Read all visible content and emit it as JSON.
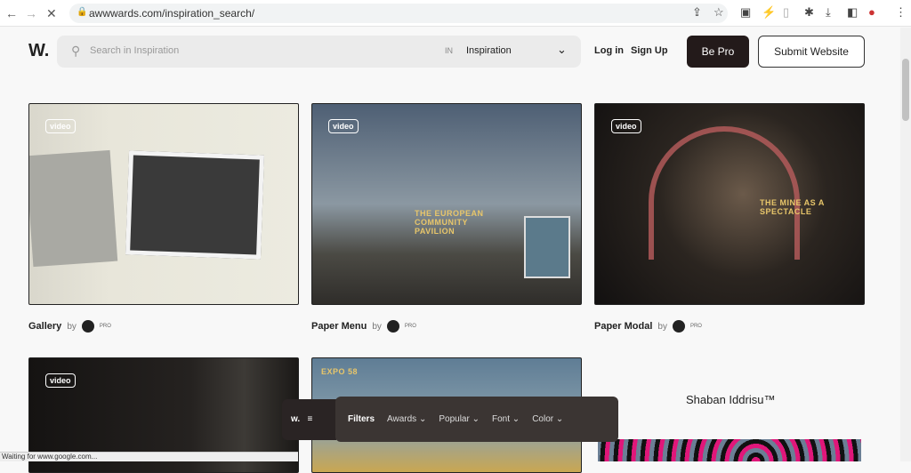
{
  "browser": {
    "url": "awwwards.com/inspiration_search/",
    "status": "Waiting for www.google.com..."
  },
  "header": {
    "logo": "W.",
    "search_placeholder": "Search in Inspiration",
    "in_label": "IN",
    "category": "Inspiration",
    "login": "Log in",
    "signup": "Sign Up",
    "be_pro": "Be Pro",
    "submit": "Submit Website"
  },
  "cards": [
    {
      "title": "Gallery",
      "by": "by",
      "pro": "PRO",
      "badge": "video"
    },
    {
      "title": "Paper Menu",
      "by": "by",
      "pro": "PRO",
      "badge": "video",
      "overlay": "THE EUROPEAN COMMUNITY PAVILION"
    },
    {
      "title": "Paper Modal",
      "by": "by",
      "pro": "PRO",
      "badge": "video",
      "overlay": "THE MINE AS A SPECTACLE"
    },
    {
      "badge": "video"
    },
    {
      "overlay": "EXPO 58"
    },
    {
      "title": "Shaban Iddrisu™"
    }
  ],
  "filterbar": {
    "logo": "w.",
    "filters": "Filters",
    "items": [
      "Awards",
      "Popular",
      "Font",
      "Color"
    ]
  }
}
